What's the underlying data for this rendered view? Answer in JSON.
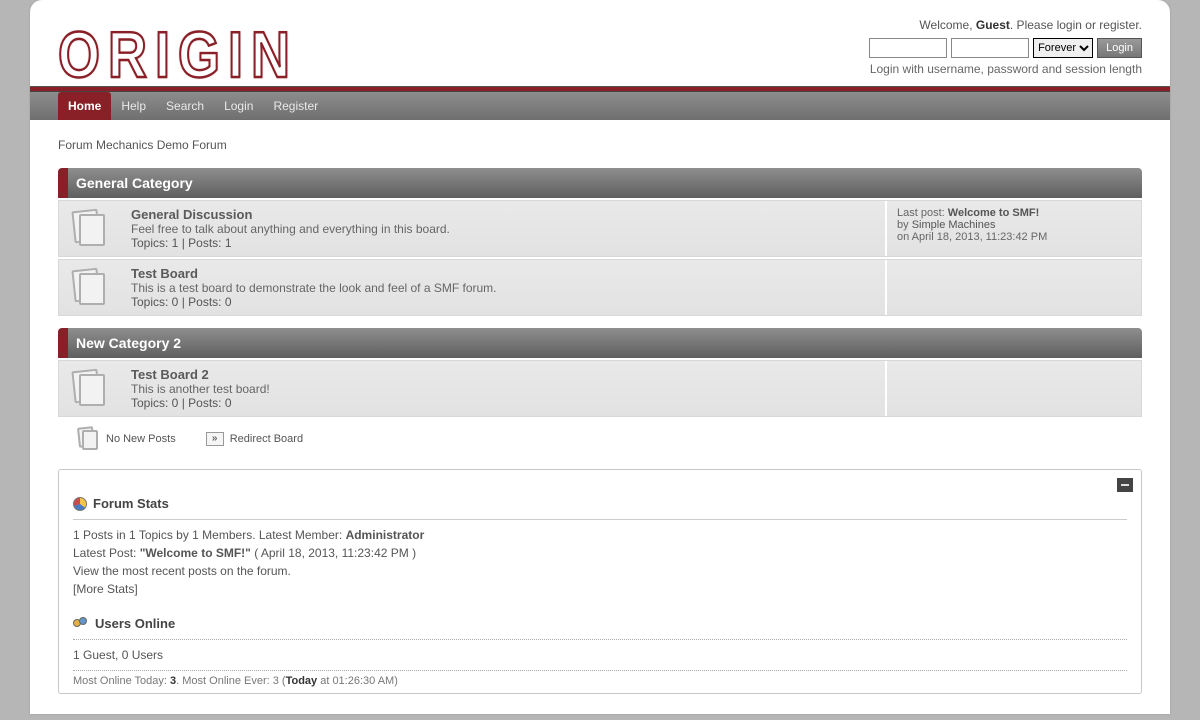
{
  "logo": "ORIGIN",
  "welcome": {
    "pre": "Welcome, ",
    "guest": "Guest",
    "post": ". Please ",
    "login": "login",
    "or": " or ",
    "register": "register",
    "end": "."
  },
  "loginForm": {
    "session": "Forever",
    "button": "Login",
    "hint": "Login with username, password and session length"
  },
  "nav": [
    {
      "label": "Home",
      "active": true
    },
    {
      "label": "Help"
    },
    {
      "label": "Search"
    },
    {
      "label": "Login"
    },
    {
      "label": "Register"
    }
  ],
  "linktree": "Forum Mechanics Demo Forum",
  "categories": [
    {
      "title": "General Category",
      "boards": [
        {
          "name": "General Discussion",
          "desc": "Feel free to talk about anything and everything in this board.",
          "stats": "Topics: 1 | Posts: 1",
          "last": {
            "label": "Last post: ",
            "title": "Welcome to SMF!",
            "by": "by ",
            "author": "Simple Machines",
            "date": "on April 18, 2013, 11:23:42 PM"
          }
        },
        {
          "name": "Test Board",
          "desc": "This is a test board to demonstrate the look and feel of a SMF forum.",
          "stats": "Topics: 0 | Posts: 0",
          "last": null
        }
      ]
    },
    {
      "title": "New Category 2",
      "boards": [
        {
          "name": "Test Board 2",
          "desc": "This is another test board!",
          "stats": "Topics: 0 | Posts: 0",
          "last": null
        }
      ]
    }
  ],
  "legend": {
    "noNew": "No New Posts",
    "redirect": "Redirect Board"
  },
  "stats": {
    "head": "Forum Stats",
    "line1a": "1 Posts in 1 Topics by 1 Members. Latest Member: ",
    "line1b": "Administrator",
    "line2a": "Latest Post: ",
    "line2b": "\"Welcome to SMF!\"",
    "line2c": " ( April 18, 2013, 11:23:42 PM )",
    "line3": "View the most recent posts on the forum.",
    "line4": "[More Stats]"
  },
  "online": {
    "head": "Users Online",
    "body": "1 Guest, 0 Users",
    "most1": "Most Online Today: ",
    "most1v": "3",
    "most2": ". Most Online Ever: 3 (",
    "most2v": "Today",
    "most3": " at 01:26:30 AM)"
  }
}
